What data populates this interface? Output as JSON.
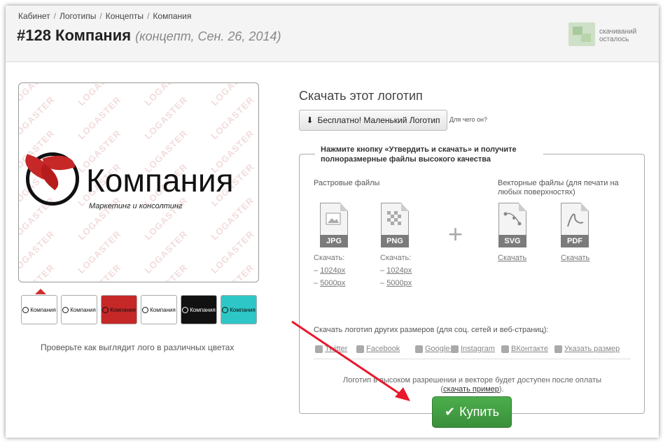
{
  "breadcrumb": [
    "Кабинет",
    "Логотипы",
    "Концепты",
    "Компания"
  ],
  "page": {
    "title": "#128 Компания",
    "subtitle": "(концепт, Сен. 26, 2014)"
  },
  "downloads_left": {
    "line1": "скачиваний",
    "line2": "осталось"
  },
  "preview": {
    "company_name": "Компания",
    "slogan": "Маркетинг и консолтинг",
    "watermark": "LOGASTER"
  },
  "thumbnails": [
    {
      "label": "Компания",
      "bg": "#ffffff",
      "fg": "#111111"
    },
    {
      "label": "Компания",
      "bg": "#ffffff",
      "fg": "#111111"
    },
    {
      "label": "Компания",
      "bg": "#c62828",
      "fg": "#111111"
    },
    {
      "label": "Компания",
      "bg": "#ffffff",
      "fg": "#111111"
    },
    {
      "label": "Компания",
      "bg": "#111111",
      "fg": "#ffffff"
    },
    {
      "label": "Компания",
      "bg": "#2ec7c7",
      "fg": "#111111"
    }
  ],
  "color_hint": "Проверьте как выглядит лого в различных цветах",
  "download": {
    "title": "Скачать этот логотип",
    "free_button": "Бесплатно! Маленький Логотип",
    "free_question": "Для чего он?",
    "box_legend": "Нажмите кнопку «Утвердить и скачать» и получите полноразмерные файлы высокого качества",
    "raster_title": "Растровые файлы",
    "vector_title": "Векторные файлы (для печати на любых поверхностях)",
    "files": {
      "jpg": {
        "ext": "JPG",
        "label": "Скачать:",
        "sizes": [
          "1024px",
          "5000px"
        ]
      },
      "png": {
        "ext": "PNG",
        "label": "Скачать:",
        "sizes": [
          "1024px",
          "5000px"
        ]
      },
      "svg": {
        "ext": "SVG",
        "link": "Скачать"
      },
      "pdf": {
        "ext": "PDF",
        "link": "Скачать"
      }
    },
    "plus": "+",
    "other_sizes_title": "Скачать логотип других размеров (для соц. сетей и веб-страниц):",
    "social": [
      "Twitter",
      "Facebook",
      "Google+",
      "Instagram",
      "ВКонтакте",
      "Указать размер"
    ],
    "note_text": "Логотип в высоком разрешении и векторе будет доступен после оплаты",
    "note_link": "скачать пример",
    "buy_button": "Купить"
  },
  "colors": {
    "accent_red": "#c62828",
    "buy_green": "#44a544",
    "arrow_red": "#e8192c"
  }
}
